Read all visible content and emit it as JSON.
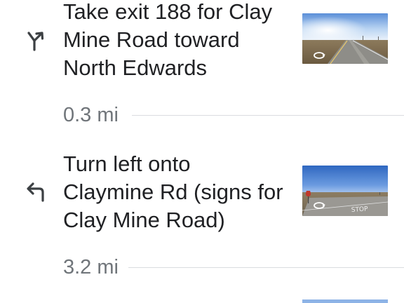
{
  "steps": [
    {
      "instruction_lines": [
        "Take exit 188 for Clay",
        "Mine Road toward",
        "North Edwards"
      ],
      "icon": "slight-right-exit-icon",
      "distance": "0.3 mi"
    },
    {
      "instruction_lines": [
        "Turn left onto",
        "Claymine Rd (signs for",
        "Clay Mine Road)"
      ],
      "icon": "turn-left-icon",
      "distance": "3.2 mi"
    }
  ],
  "thumbnails": {
    "step2_sign_text": "STOP"
  },
  "colors": {
    "text_primary": "#202124",
    "text_secondary": "#70757a",
    "divider": "#dadce0",
    "sky_blue": "#3f79c9"
  }
}
